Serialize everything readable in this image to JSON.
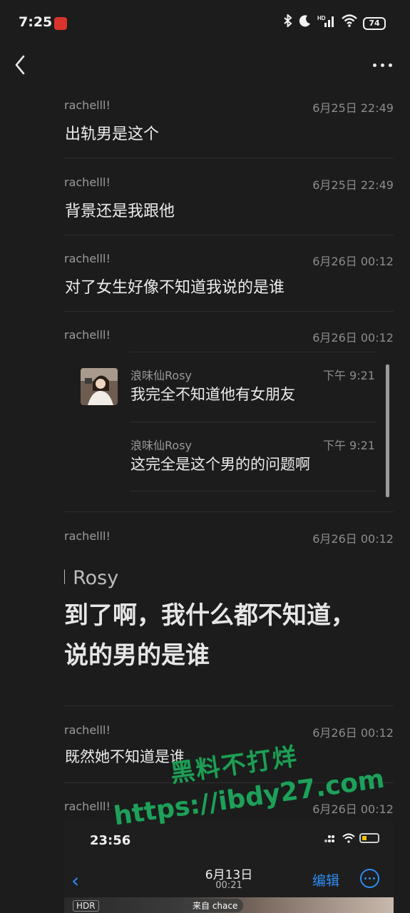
{
  "status_bar": {
    "time": "7:25",
    "app_icon": "app-notification-icon",
    "icons": [
      "bluetooth-icon",
      "moon-icon",
      "signal-icon",
      "wifi-icon"
    ],
    "signal_label": "HD",
    "battery": "74"
  },
  "nav": {
    "back_icon": "chevron-left-icon",
    "more_icon": "more-dots-icon"
  },
  "messages": [
    {
      "sender": "rachelll!",
      "time": "6月25日 22:49",
      "text": "出轨男是这个"
    },
    {
      "sender": "rachelll!",
      "time": "6月25日 22:49",
      "text": "背景还是我跟他"
    },
    {
      "sender": "rachelll!",
      "time": "6月26日 00:12",
      "text": "对了女生好像不知道我说的是谁"
    },
    {
      "sender": "rachelll!",
      "time": "6月26日 00:12"
    },
    {
      "sender": "rachelll!",
      "time": "6月26日 00:12"
    },
    {
      "sender": "rachelll!",
      "time": "6月26日 00:12",
      "text": "既然她不知道是谁"
    },
    {
      "sender": "rachelll!",
      "time": "6月26日 00:12"
    }
  ],
  "quoted": [
    {
      "sender": "浪味仙Rosy",
      "time": "下午 9:21",
      "text": "我完全不知道他有女朋友"
    },
    {
      "sender": "浪味仙Rosy",
      "time": "下午 9:21",
      "text": "这完全是这个男的的问题啊"
    }
  ],
  "zoomed_screenshot": {
    "name_fragment": "l Rosy",
    "line1": "到了啊，我什么都不知道，",
    "line2": "说的男的是谁"
  },
  "watermark": {
    "line1": "黑料不打烊",
    "line2": "https://ibdy27.com"
  },
  "embedded_screenshot": {
    "time": "23:56",
    "date": "6月13日",
    "sub_time": "00:21",
    "edit_label": "编辑",
    "hdr_label": "HDR",
    "source_label": "来自 chace"
  },
  "colors": {
    "background": "#1c1c1c",
    "accent_blue": "#2e8cf5",
    "watermark_green": "#1fa05a"
  }
}
